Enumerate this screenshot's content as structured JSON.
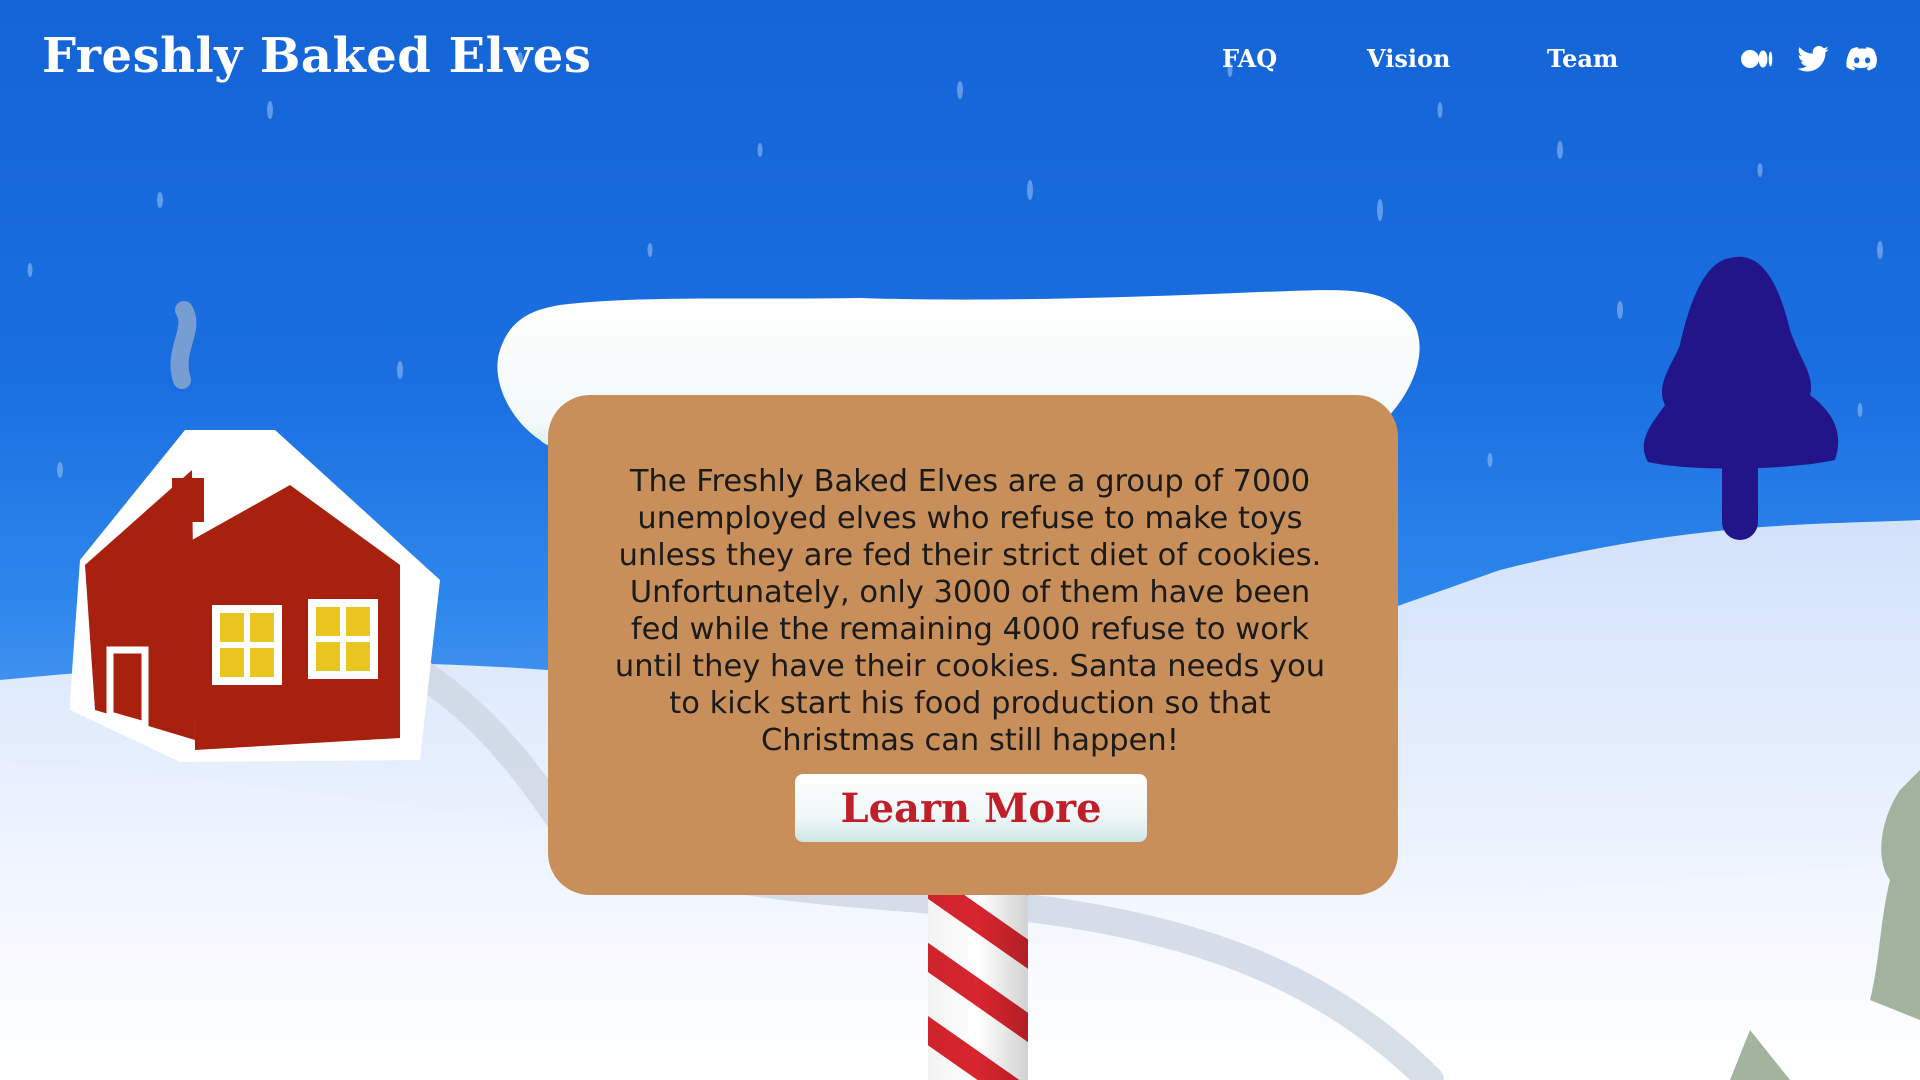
{
  "site": {
    "title": "Freshly Baked Elves"
  },
  "nav": {
    "links": [
      "FAQ",
      "Vision",
      "Team"
    ]
  },
  "social": {
    "icons": [
      "medium-icon",
      "twitter-icon",
      "discord-icon"
    ]
  },
  "sign": {
    "lines": [
      "The Freshly Baked Elves are a group of 7000",
      "unemployed elves who refuse to make toys",
      "unless they are fed their strict diet of cookies.",
      "Unfortunately, only 3000 of them have been",
      "fed while the remaining 4000 refuse to work",
      "until they have their cookies. Santa needs you",
      "to kick start his food production so that",
      "Christmas can still happen!"
    ],
    "button_label": "Learn More"
  },
  "colors": {
    "sky": "#1464d6",
    "snow": "#ffffff",
    "sign_wood": "#c88f5b",
    "house_red": "#a8210f",
    "window_yellow": "#e8c51f",
    "tree_dark": "#22158a",
    "tree_far": "#9aab92",
    "pole_red": "#d8252e",
    "button_text": "#c01f2a"
  }
}
